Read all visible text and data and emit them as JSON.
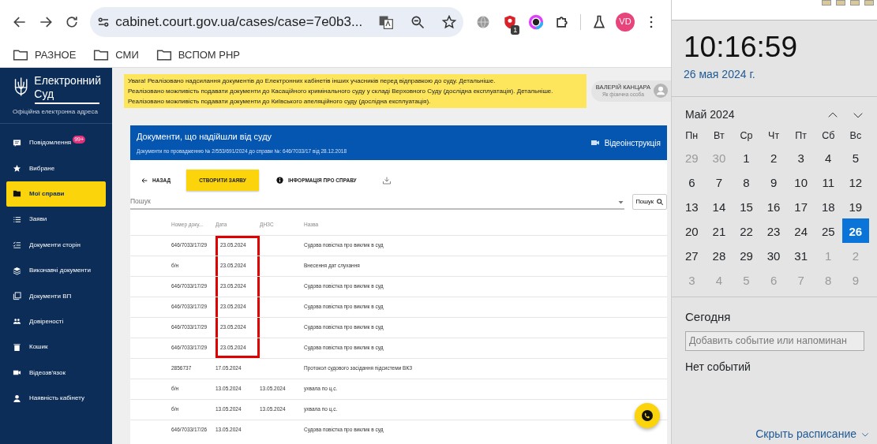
{
  "browser": {
    "url": "cabinet.court.gov.ua/cases/case=7e0b3...",
    "extension_badge": "1",
    "avatar": "VD",
    "bookmarks": [
      "РАЗНОЕ",
      "СМИ",
      "ВСПОМ PHP"
    ]
  },
  "sidebar": {
    "logo_line1": "Електронний",
    "logo_line2": "Суд",
    "subtitle": "Офіційна електронна адреса",
    "items": [
      {
        "kind": "message",
        "label": "Повідомлення",
        "badge": "99+",
        "selected": false
      },
      {
        "kind": "star",
        "label": "Вибране",
        "selected": false
      },
      {
        "kind": "folder",
        "label": "Мої справи",
        "selected": true
      },
      {
        "kind": "list",
        "label": "Заяви",
        "selected": false
      },
      {
        "kind": "checklist",
        "label": "Документи сторін",
        "selected": false
      },
      {
        "kind": "layers",
        "label": "Виконавчі документи",
        "selected": false
      },
      {
        "kind": "copy",
        "label": "Документи ВП",
        "selected": false
      },
      {
        "kind": "people",
        "label": "Довіреності",
        "selected": false
      },
      {
        "kind": "trash",
        "label": "Кошик",
        "selected": false
      },
      {
        "kind": "video",
        "label": "Відеозв'язок",
        "selected": false
      },
      {
        "kind": "person",
        "label": "Наявність кабінету",
        "selected": false
      }
    ]
  },
  "notice": {
    "lines": [
      {
        "text": "Увага! Реалізовано надсилання документів до Електронних кабінетів інших учасників перед відправкою до суду.",
        "link": "Детальніше."
      },
      {
        "text": "Реалізовано можливість подавати документи до Касаційного кримінального суду у складі Верховного Суду (дослідна експлуатація).",
        "link": "Детальніше."
      },
      {
        "text": "Реалізовано можливість подавати документи до Київського апеляційного суду (дослідна експлуатація)."
      }
    ]
  },
  "user": {
    "name": "ВАЛЕРІЙ КАНЦАРА",
    "role": "Як фізична особа"
  },
  "card": {
    "title": "Документи, що надійшли від суду",
    "subtitle": "Документи по провадженню № 2/553/691/2024 до справи №: 646/7033/17 від 28.12.2018",
    "video_link": "Відеоінструкція"
  },
  "toolbar": {
    "back": "НАЗАД",
    "create": "СТВОРИТИ ЗАЯВУ",
    "info": "ІНФОРМАЦІЯ ПРО СПРАВУ"
  },
  "search": {
    "placeholder": "Пошук",
    "button": "Пошук"
  },
  "table": {
    "columns": [
      "Номер доку...",
      "Дата",
      "ДНЗС",
      "Назва"
    ],
    "rows": [
      {
        "cells": [
          "646/7033/17/29",
          "23.05.2024",
          "",
          "Судова повістка про виклик в суд"
        ],
        "highlighted": true
      },
      {
        "cells": [
          "б/н",
          "23.05.2024",
          "",
          "Внесення дат слухання"
        ],
        "highlighted": true
      },
      {
        "cells": [
          "646/7033/17/29",
          "23.05.2024",
          "",
          "Судова повістка про виклик в суд"
        ],
        "highlighted": true
      },
      {
        "cells": [
          "646/7033/17/29",
          "23.05.2024",
          "",
          "Судова повістка про виклик в суд"
        ],
        "highlighted": true
      },
      {
        "cells": [
          "646/7033/17/29",
          "23.05.2024",
          "",
          "Судова повістка про виклик в суд"
        ],
        "highlighted": true
      },
      {
        "cells": [
          "646/7033/17/29",
          "23.05.2024",
          "",
          "Судова повістка про виклик в суд"
        ],
        "highlighted": true
      },
      {
        "cells": [
          "2856737",
          "17.05.2024",
          "",
          "Протокол судового засідання підсистеми ВКЗ"
        ],
        "highlighted": false
      },
      {
        "cells": [
          "б/н",
          "13.05.2024",
          "13.05.2024",
          "ухвала по ц.с."
        ],
        "highlighted": false
      },
      {
        "cells": [
          "б/н",
          "13.05.2024",
          "13.05.2024",
          "ухвала по ц.с."
        ],
        "highlighted": false
      },
      {
        "cells": [
          "646/7033/17/26",
          "13.05.2024",
          "",
          "Судова повістка про виклик в суд"
        ],
        "highlighted": false
      }
    ]
  },
  "calendar": {
    "time": "10:16:59",
    "date": "26 мая 2024 г.",
    "month": "Май 2024",
    "weekdays": [
      "Пн",
      "Вт",
      "Ср",
      "Чт",
      "Пт",
      "Сб",
      "Вс"
    ],
    "days": [
      {
        "d": "29",
        "muted": true,
        "selected": false
      },
      {
        "d": "30",
        "muted": true,
        "selected": false
      },
      {
        "d": "1",
        "muted": false,
        "selected": false
      },
      {
        "d": "2",
        "muted": false,
        "selected": false
      },
      {
        "d": "3",
        "muted": false,
        "selected": false
      },
      {
        "d": "4",
        "muted": false,
        "selected": false
      },
      {
        "d": "5",
        "muted": false,
        "selected": false
      },
      {
        "d": "6",
        "muted": false,
        "selected": false
      },
      {
        "d": "7",
        "muted": false,
        "selected": false
      },
      {
        "d": "8",
        "muted": false,
        "selected": false
      },
      {
        "d": "9",
        "muted": false,
        "selected": false
      },
      {
        "d": "10",
        "muted": false,
        "selected": false
      },
      {
        "d": "11",
        "muted": false,
        "selected": false
      },
      {
        "d": "12",
        "muted": false,
        "selected": false
      },
      {
        "d": "13",
        "muted": false,
        "selected": false
      },
      {
        "d": "14",
        "muted": false,
        "selected": false
      },
      {
        "d": "15",
        "muted": false,
        "selected": false
      },
      {
        "d": "16",
        "muted": false,
        "selected": false
      },
      {
        "d": "17",
        "muted": false,
        "selected": false
      },
      {
        "d": "18",
        "muted": false,
        "selected": false
      },
      {
        "d": "19",
        "muted": false,
        "selected": false
      },
      {
        "d": "20",
        "muted": false,
        "selected": false
      },
      {
        "d": "21",
        "muted": false,
        "selected": false
      },
      {
        "d": "22",
        "muted": false,
        "selected": false
      },
      {
        "d": "23",
        "muted": false,
        "selected": false
      },
      {
        "d": "24",
        "muted": false,
        "selected": false
      },
      {
        "d": "25",
        "muted": false,
        "selected": false
      },
      {
        "d": "26",
        "muted": false,
        "selected": true
      },
      {
        "d": "27",
        "muted": false,
        "selected": false
      },
      {
        "d": "28",
        "muted": false,
        "selected": false
      },
      {
        "d": "29",
        "muted": false,
        "selected": false
      },
      {
        "d": "30",
        "muted": false,
        "selected": false
      },
      {
        "d": "31",
        "muted": false,
        "selected": false
      },
      {
        "d": "1",
        "muted": true,
        "selected": false
      },
      {
        "d": "2",
        "muted": true,
        "selected": false
      },
      {
        "d": "3",
        "muted": true,
        "selected": false
      },
      {
        "d": "4",
        "muted": true,
        "selected": false
      },
      {
        "d": "5",
        "muted": true,
        "selected": false
      },
      {
        "d": "6",
        "muted": true,
        "selected": false
      },
      {
        "d": "7",
        "muted": true,
        "selected": false
      },
      {
        "d": "8",
        "muted": true,
        "selected": false
      },
      {
        "d": "9",
        "muted": true,
        "selected": false
      }
    ],
    "today_label": "Сегодня",
    "event_placeholder": "Добавить событие или напоминан",
    "no_events": "Нет событий",
    "hide_link": "Скрыть расписание"
  }
}
